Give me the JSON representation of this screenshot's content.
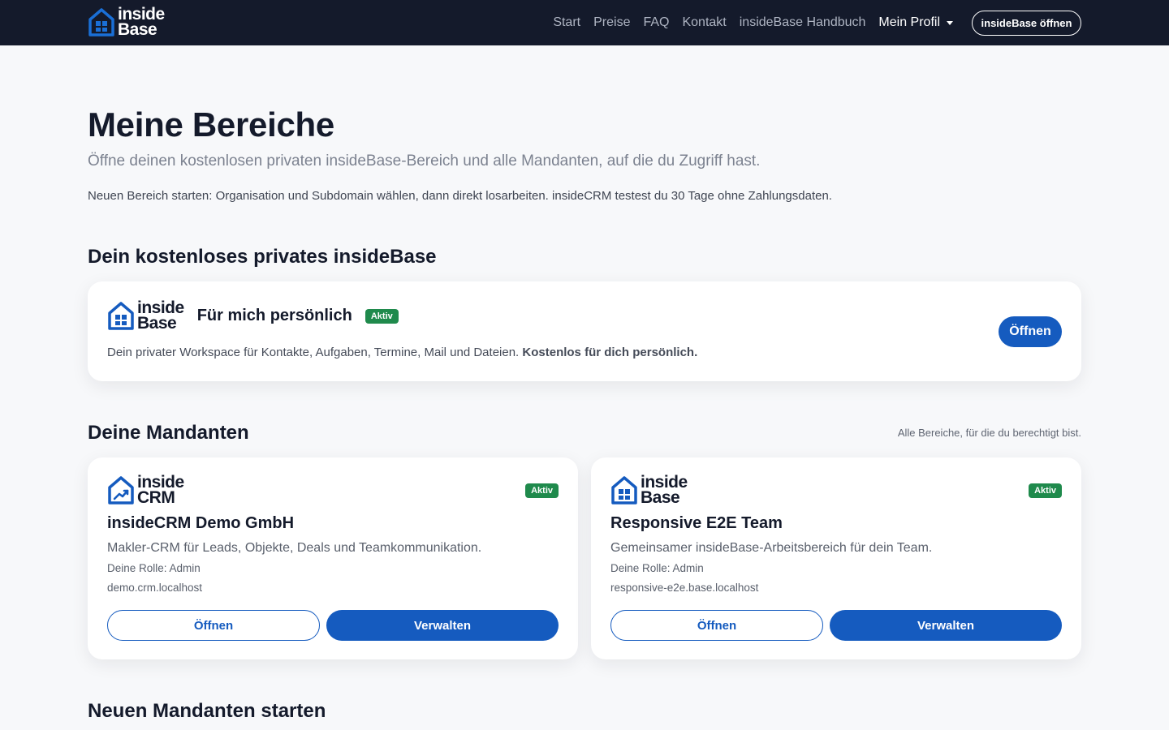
{
  "brand": {
    "name_line1": "inside",
    "name_line2": "Base",
    "primary_color": "#155bbf",
    "nav_bg": "#141a2b",
    "success_color": "#1f8a4c"
  },
  "nav": {
    "links": [
      "Start",
      "Preise",
      "FAQ",
      "Kontakt",
      "insideBase Handbuch"
    ],
    "profile_label": "Mein Profil",
    "open_button": "insideBase öffnen"
  },
  "page": {
    "title": "Meine Bereiche",
    "subtitle": "Öffne deinen kostenlosen privaten insideBase-Bereich und alle Mandanten, auf die du Zugriff hast.",
    "note": "Neuen Bereich starten: Organisation und Subdomain wählen, dann direkt losarbeiten. insideCRM testest du 30 Tage ohne Zahlungsdaten."
  },
  "private_section": {
    "title": "Dein kostenloses privates insideBase",
    "card": {
      "logo_line1": "inside",
      "logo_line2": "Base",
      "name": "Für mich persönlich",
      "badge": "Aktiv",
      "description": "Dein privater Workspace für Kontakte, Aufgaben, Termine, Mail und Dateien.",
      "description_strong": "Kostenlos für dich persönlich.",
      "open_button": "Öffnen"
    }
  },
  "tenants_section": {
    "title": "Deine Mandanten",
    "hint": "Alle Bereiche, für die du berechtigt bist.",
    "tenants": [
      {
        "logo_line1": "inside",
        "logo_line2": "CRM",
        "logo_icon": "crm-chart-house-icon",
        "name": "insideCRM Demo GmbH",
        "badge": "Aktiv",
        "description": "Makler-CRM für Leads, Objekte, Deals und Teamkommunikation.",
        "role": "Deine Rolle: Admin",
        "domain": "demo.crm.localhost",
        "open_button": "Öffnen",
        "manage_button": "Verwalten"
      },
      {
        "logo_line1": "inside",
        "logo_line2": "Base",
        "logo_icon": "base-house-icon",
        "name": "Responsive E2E Team",
        "badge": "Aktiv",
        "description": "Gemeinsamer insideBase-Arbeitsbereich für dein Team.",
        "role": "Deine Rolle: Admin",
        "domain": "responsive-e2e.base.localhost",
        "open_button": "Öffnen",
        "manage_button": "Verwalten"
      }
    ]
  },
  "new_tenant_section": {
    "title": "Neuen Mandanten starten"
  }
}
